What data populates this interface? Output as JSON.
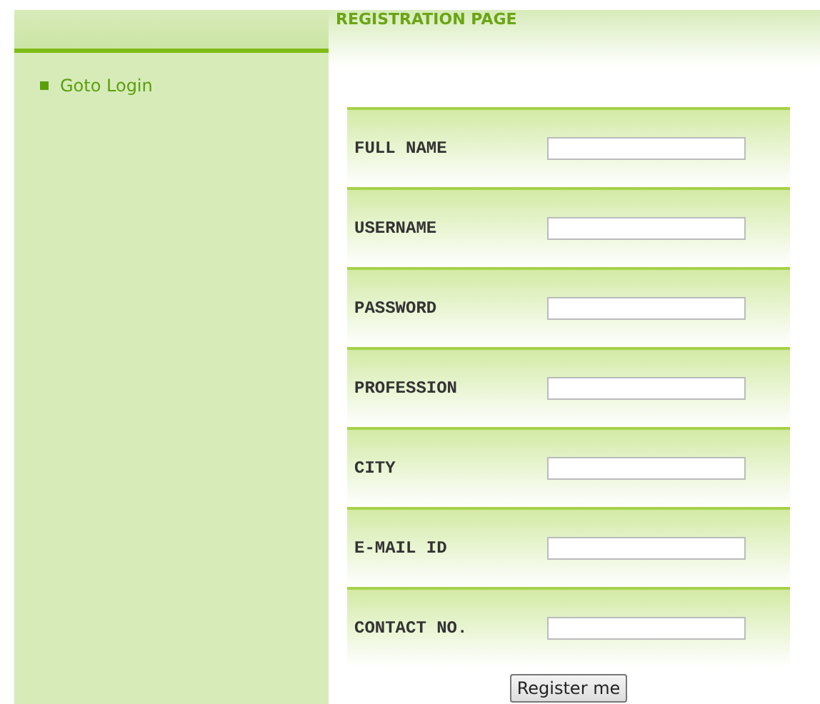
{
  "sidebar": {
    "items": [
      {
        "label": "Goto Login"
      }
    ]
  },
  "title": "REGISTRATION PAGE",
  "form": {
    "fields": [
      {
        "label": "FULL NAME"
      },
      {
        "label": "USERNAME"
      },
      {
        "label": "PASSWORD"
      },
      {
        "label": "PROFESSION"
      },
      {
        "label": "CITY"
      },
      {
        "label": "E-MAIL ID"
      },
      {
        "label": "CONTACT NO."
      }
    ],
    "submit": "Register me"
  }
}
